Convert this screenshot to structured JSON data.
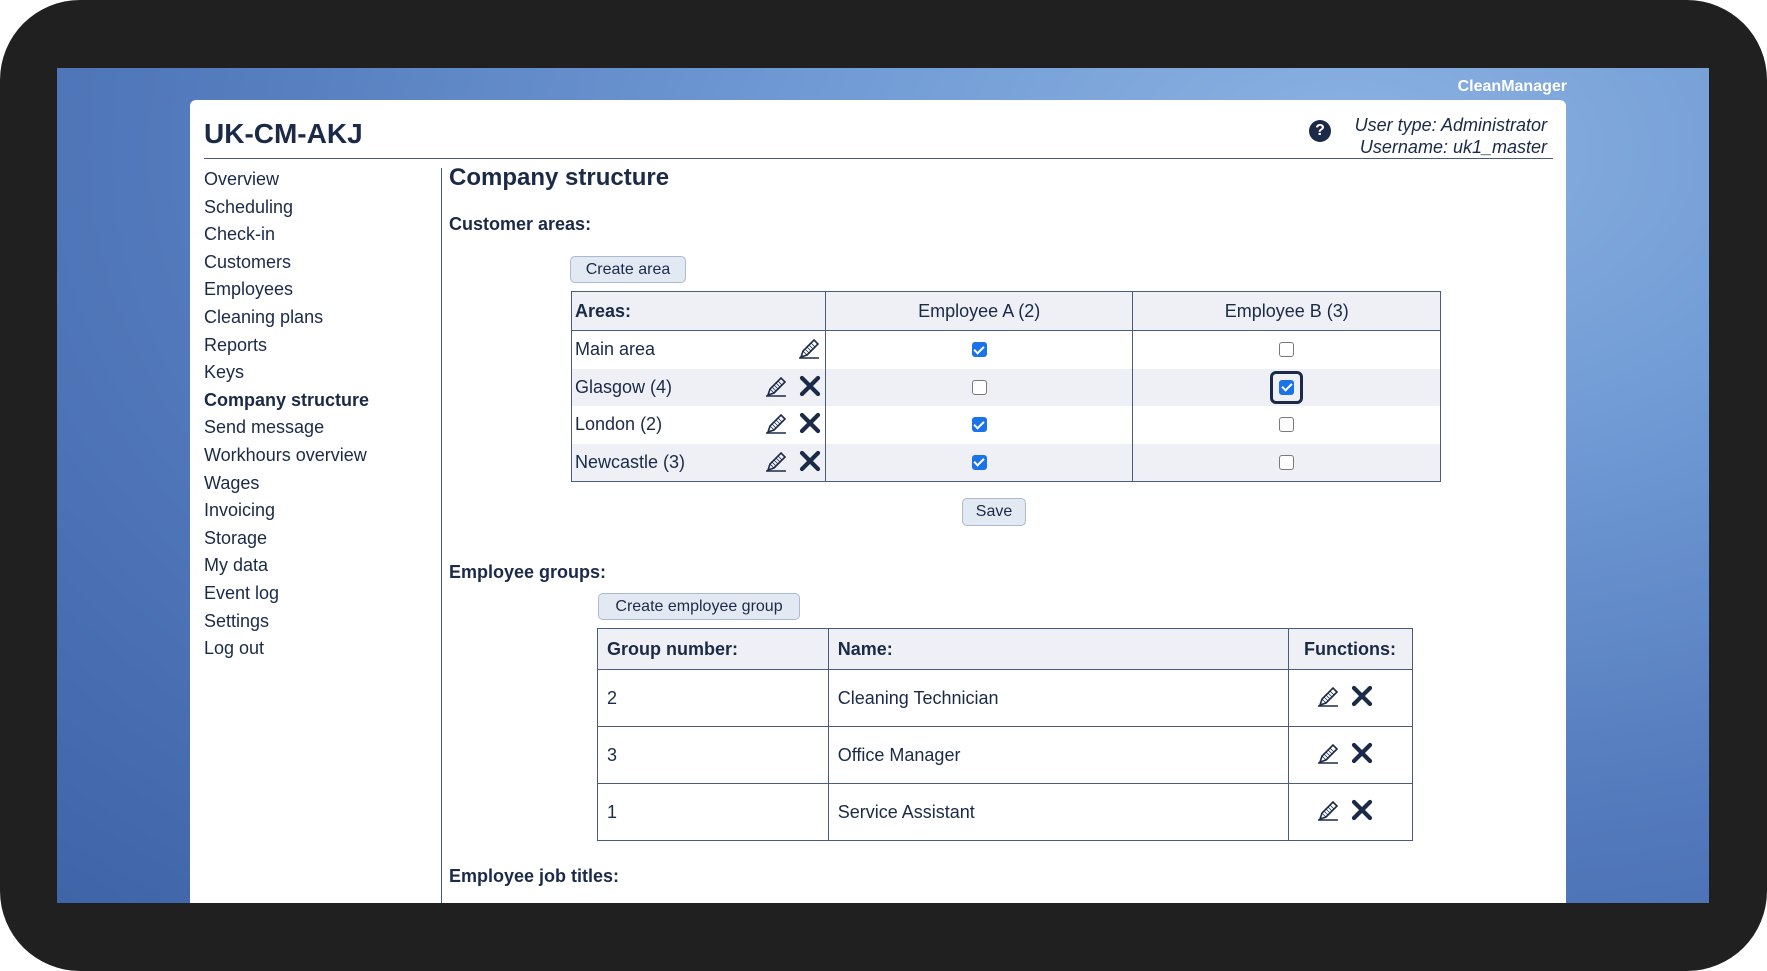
{
  "app": {
    "brand": "CleanManager",
    "account_title": "UK-CM-AKJ",
    "user_type": "User type: Administrator",
    "username": "Username: uk1_master"
  },
  "sidebar": {
    "items": [
      {
        "label": "Overview"
      },
      {
        "label": "Scheduling"
      },
      {
        "label": "Check-in"
      },
      {
        "label": "Customers"
      },
      {
        "label": "Employees"
      },
      {
        "label": "Cleaning plans"
      },
      {
        "label": "Reports"
      },
      {
        "label": "Keys"
      },
      {
        "label": "Company structure",
        "active": true
      },
      {
        "label": "Send message"
      },
      {
        "label": "Workhours overview"
      },
      {
        "label": "Wages"
      },
      {
        "label": "Invoicing"
      },
      {
        "label": "Storage"
      },
      {
        "label": "My data"
      },
      {
        "label": "Event log"
      },
      {
        "label": "Settings"
      },
      {
        "label": "Log out"
      }
    ]
  },
  "main": {
    "page_title": "Company structure",
    "customer_areas": {
      "section_title": "Customer areas:",
      "create_button": "Create area",
      "save_button": "Save",
      "headers": [
        "Areas:",
        "Employee A (2)",
        "Employee B (3)"
      ],
      "rows": [
        {
          "name": "Main area",
          "employee_a": true,
          "employee_b": false,
          "deletable": false
        },
        {
          "name": "Glasgow (4)",
          "employee_a": false,
          "employee_b": true,
          "deletable": true
        },
        {
          "name": "London (2)",
          "employee_a": true,
          "employee_b": false,
          "deletable": true
        },
        {
          "name": "Newcastle (3)",
          "employee_a": true,
          "employee_b": false,
          "deletable": true
        }
      ]
    },
    "employee_groups": {
      "section_title": "Employee groups:",
      "create_button": "Create employee group",
      "headers": [
        "Group number:",
        "Name:",
        "Functions:"
      ],
      "rows": [
        {
          "number": "2",
          "name": "Cleaning Technician"
        },
        {
          "number": "3",
          "name": "Office Manager"
        },
        {
          "number": "1",
          "name": "Service Assistant"
        }
      ]
    },
    "job_titles": {
      "section_title": "Employee job titles:"
    }
  },
  "colors": {
    "text": "#1a2a47",
    "checkbox_checked": "#1a73e8",
    "header_bg": "#eef0f6",
    "button_bg": "#e2e9f3"
  }
}
